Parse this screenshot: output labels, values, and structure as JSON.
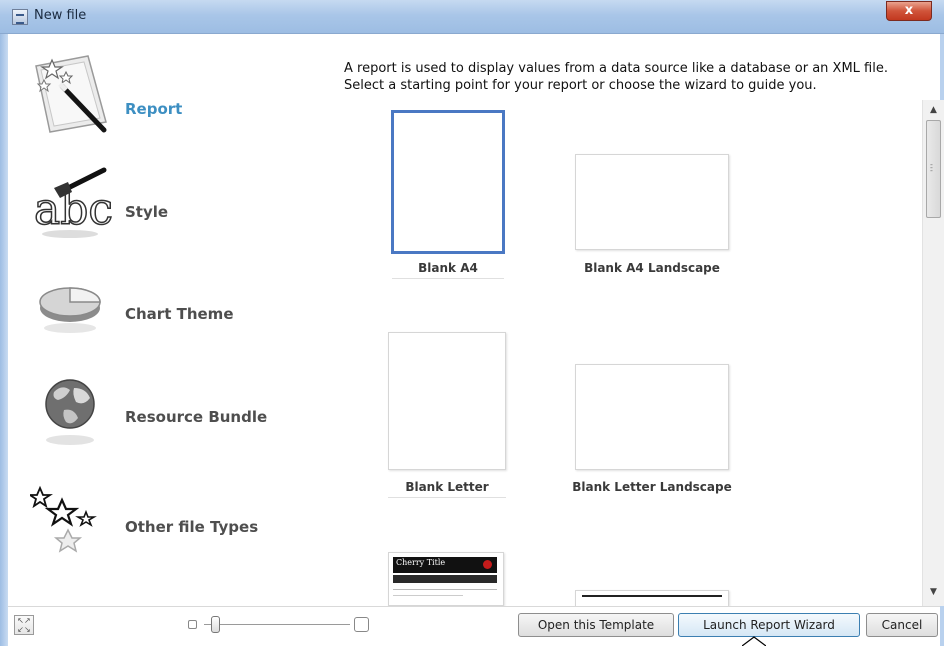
{
  "window": {
    "title": "New file",
    "close_glyph": "x"
  },
  "sidebar": {
    "items": [
      {
        "label": "Report",
        "icon": "magic-wand-icon",
        "selected": true
      },
      {
        "label": "Style",
        "icon": "paint-brush-abc-icon",
        "selected": false
      },
      {
        "label": "Chart Theme",
        "icon": "pie-chart-icon",
        "selected": false
      },
      {
        "label": "Resource Bundle",
        "icon": "globe-icon",
        "selected": false
      },
      {
        "label": "Other file Types",
        "icon": "stars-icon",
        "selected": false
      }
    ]
  },
  "main": {
    "description_line1": "A report is used to display values from a data source like a database or an XML file.",
    "description_line2": "Select a starting point for your report or choose the wizard to guide you.",
    "templates": [
      {
        "label": "Blank A4",
        "selected": true
      },
      {
        "label": "Blank A4 Landscape",
        "selected": false
      },
      {
        "label": "Blank Letter",
        "selected": false
      },
      {
        "label": "Blank Letter Landscape",
        "selected": false
      },
      {
        "label": "",
        "preview_title": "Cherry Title",
        "selected": false
      },
      {
        "label": "",
        "selected": false
      }
    ]
  },
  "footer": {
    "open_template": "Open this Template",
    "launch_wizard": "Launch Report Wizard",
    "cancel": "Cancel"
  },
  "colors": {
    "selected_label": "#3d8fc2",
    "selection_border": "#4a78c3",
    "titlebar": "#a9c6e8",
    "close": "#c2381f"
  }
}
